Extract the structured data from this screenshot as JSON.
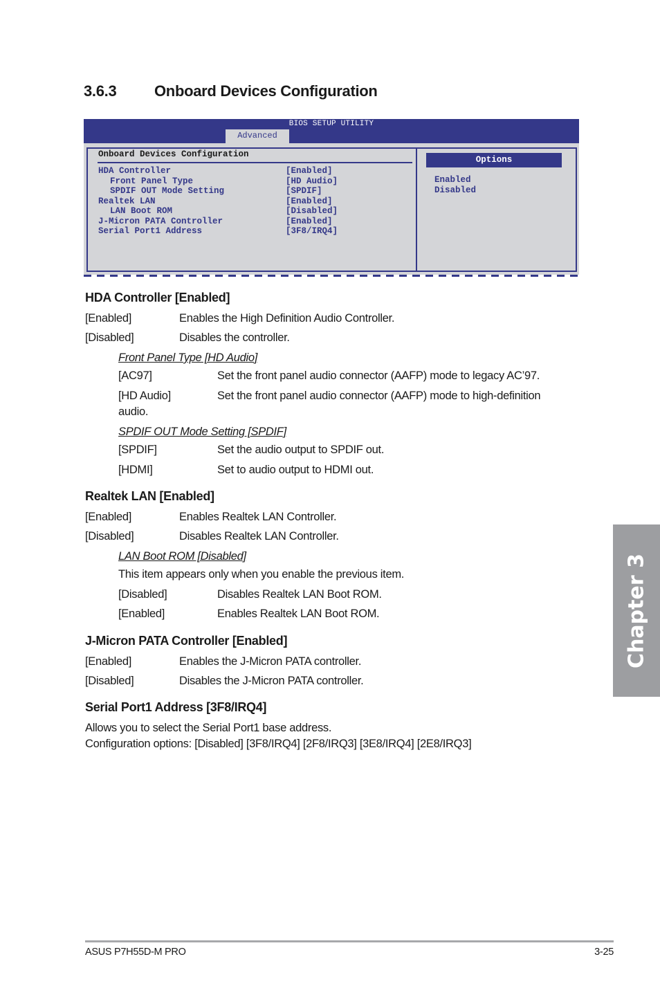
{
  "section": {
    "number": "3.6.3",
    "title": "Onboard Devices Configuration"
  },
  "bios": {
    "utility_title": "BIOS SETUP UTILITY",
    "active_tab": "Advanced",
    "panel_title": "Onboard Devices Configuration",
    "items": [
      {
        "label": "HDA Controller",
        "value": "[Enabled]",
        "indent": false
      },
      {
        "label": "Front Panel Type",
        "value": "[HD Audio]",
        "indent": true
      },
      {
        "label": "SPDIF OUT Mode Setting",
        "value": "[SPDIF]",
        "indent": true
      },
      {
        "label": "Realtek LAN",
        "value": "[Enabled]",
        "indent": false
      },
      {
        "label": "LAN Boot ROM",
        "value": "[Disabled]",
        "indent": true
      },
      {
        "label": "J-Micron PATA Controller",
        "value": "[Enabled]",
        "indent": false
      },
      {
        "label": "Serial Port1 Address",
        "value": "[3F8/IRQ4]",
        "indent": false
      }
    ],
    "options_title": "Options",
    "options": [
      "Enabled",
      "Disabled"
    ],
    "colors": {
      "frame": "#343889",
      "background": "#d4d5d8"
    }
  },
  "hda": {
    "heading": "HDA Controller [Enabled]",
    "options": [
      {
        "key": "[Enabled]",
        "desc": "Enables the High Definition Audio Controller."
      },
      {
        "key": "[Disabled]",
        "desc": "Disables the controller."
      }
    ],
    "front_panel": {
      "heading": "Front Panel Type [HD Audio]",
      "options": [
        {
          "key": "[AC97]",
          "desc": "Set the front panel audio connector (AAFP) mode to legacy AC’97."
        },
        {
          "key": "[HD Audio]",
          "desc": "Set the front panel audio connector (AAFP) mode to high-definition",
          "cont": "audio."
        }
      ]
    },
    "spdif": {
      "heading": "SPDIF OUT Mode Setting [SPDIF]",
      "options": [
        {
          "key": "[SPDIF]",
          "desc": "Set the audio output to SPDIF out."
        },
        {
          "key": "[HDMI]",
          "desc": "Set to audio output to HDMI out."
        }
      ]
    }
  },
  "lan": {
    "heading": "Realtek LAN [Enabled]",
    "options": [
      {
        "key": "[Enabled]",
        "desc": "Enables Realtek LAN Controller."
      },
      {
        "key": "[Disabled]",
        "desc": "Disables Realtek LAN Controller."
      }
    ],
    "boot_rom": {
      "heading": "LAN Boot ROM [Disabled]",
      "note": "This item appears only when you enable the previous item.",
      "options": [
        {
          "key": "[Disabled]",
          "desc": "Disables Realtek LAN Boot ROM."
        },
        {
          "key": "[Enabled]",
          "desc": "Enables Realtek LAN Boot ROM."
        }
      ]
    }
  },
  "jmicron": {
    "heading": "J-Micron PATA Controller [Enabled]",
    "options": [
      {
        "key": "[Enabled]",
        "desc": "Enables the J-Micron PATA controller."
      },
      {
        "key": "[Disabled]",
        "desc": "Disables the J-Micron PATA controller."
      }
    ]
  },
  "serial": {
    "heading": "Serial Port1 Address [3F8/IRQ4]",
    "line1": "Allows you to select the Serial Port1 base address.",
    "line2": "Configuration options: [Disabled] [3F8/IRQ4] [2F8/IRQ3] [3E8/IRQ4] [2E8/IRQ3]"
  },
  "chapter_tab": "Chapter 3",
  "footer": {
    "product": "ASUS P7H55D-M PRO",
    "page": "3-25"
  }
}
